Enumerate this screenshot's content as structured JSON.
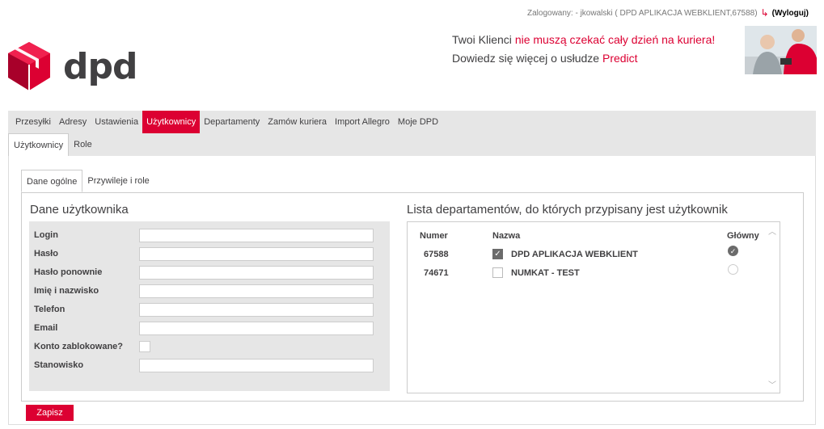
{
  "header": {
    "logged_in_text": "Zalogowany: - jkowalski ( DPD APLIKACJA WEBKLIENT,67588)",
    "logout_label": "(Wyloguj)",
    "logo_text": "dpd",
    "promo_line1_a": "Twoi Klienci ",
    "promo_line1_b": "nie muszą czekać cały dzień na kuriera!",
    "promo_line2_a": "Dowiedz się więcej o usłudze ",
    "promo_line2_b": "Predict"
  },
  "colors": {
    "brand_red": "#dc0032",
    "nav_bg": "#e6e6e6",
    "text": "#414042"
  },
  "nav": {
    "items": [
      {
        "label": "Przesyłki"
      },
      {
        "label": "Adresy"
      },
      {
        "label": "Ustawienia"
      },
      {
        "label": "Użytkownicy",
        "active": true
      },
      {
        "label": "Departamenty"
      },
      {
        "label": "Zamów kuriera"
      },
      {
        "label": "Import Allegro"
      },
      {
        "label": "Moje DPD"
      }
    ]
  },
  "subnav": {
    "items": [
      {
        "label": "Użytkownicy",
        "active": true
      },
      {
        "label": "Role"
      }
    ]
  },
  "tabs": {
    "items": [
      {
        "label": "Dane ogólne",
        "active": true
      },
      {
        "label": "Przywileje i role"
      }
    ]
  },
  "user_form": {
    "title": "Dane użytkownika",
    "fields": {
      "login": {
        "label": "Login",
        "value": ""
      },
      "password": {
        "label": "Hasło",
        "value": ""
      },
      "password_repeat": {
        "label": "Hasło ponownie",
        "value": ""
      },
      "full_name": {
        "label": "Imię i nazwisko",
        "value": ""
      },
      "phone": {
        "label": "Telefon",
        "value": ""
      },
      "email": {
        "label": "Email",
        "value": ""
      },
      "blocked": {
        "label": "Konto zablokowane?",
        "checked": false
      },
      "position": {
        "label": "Stanowisko",
        "value": ""
      }
    }
  },
  "departments": {
    "title": "Lista departamentów, do których przypisany jest użytkownik",
    "col_number": "Numer",
    "col_name": "Nazwa",
    "col_main": "Główny",
    "rows": [
      {
        "number": "67588",
        "name": "DPD APLIKACJA WEBKLIENT",
        "checked": true,
        "main": true
      },
      {
        "number": "74671",
        "name": "NUMKAT - TEST",
        "checked": false,
        "main": false
      }
    ]
  },
  "actions": {
    "save_label": "Zapisz"
  }
}
